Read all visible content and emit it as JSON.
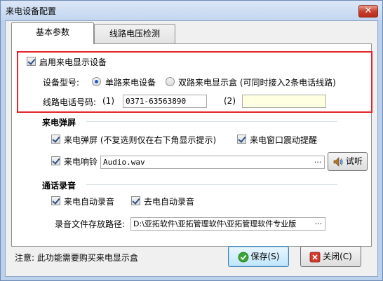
{
  "window": {
    "title": "来电设备配置",
    "close_glyph": "✕"
  },
  "tabs": [
    {
      "label": "基本参数",
      "active": true
    },
    {
      "label": "线路电压检测",
      "active": false
    }
  ],
  "caller_id": {
    "enable_label": "启用来电显示设备",
    "enabled": true,
    "device_type_label": "设备型号:",
    "options": [
      {
        "label": "单路来电设备",
        "selected": true
      },
      {
        "label": "双路来电显示盒 (可同时接入2条电话线路)",
        "selected": false
      }
    ],
    "line_number_label": "线路电话号码:",
    "line1_label": "(1)",
    "line1_value": "0371-63563890",
    "line2_label": "(2)",
    "line2_value": ""
  },
  "popup_group": {
    "title": "来电弹屏",
    "popup_label": "来电弹屏 (不复选则仅在右下角显示提示)",
    "popup_checked": true,
    "shake_label": "来电窗口震动提醒",
    "shake_checked": true,
    "ring_label": "来电响铃",
    "ring_checked": true,
    "ring_file": "Audio.wav",
    "browse_glyph": "...",
    "test_label": "试听"
  },
  "record_group": {
    "title": "通话录音",
    "incoming_label": "来电自动录音",
    "incoming_checked": true,
    "outgoing_label": "去电自动录音",
    "outgoing_checked": true,
    "path_label": "录音文件存放路径:",
    "path_value": "D:\\亚拓软件\\亚拓管理软件\\亚拓管理软件专业版",
    "browse_glyph": "..."
  },
  "footer": {
    "note": "注意: 此功能需要购买来电显示盒",
    "save_label": "保存(S)",
    "close_label": "关闭(C)"
  },
  "colors": {
    "highlight_border": "#e5232a",
    "accent": "#1d5cc1"
  }
}
